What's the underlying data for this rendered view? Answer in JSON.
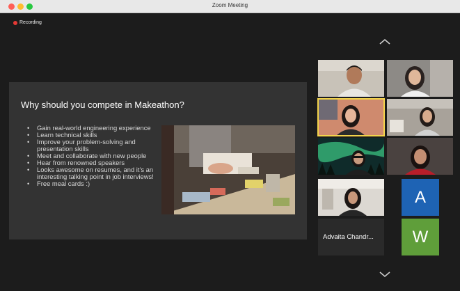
{
  "window": {
    "title": "Zoom Meeting"
  },
  "recording": {
    "label": "Recording",
    "color": "#e53935"
  },
  "navigation": {
    "up_icon": "chevron-up-icon",
    "down_icon": "chevron-down-icon"
  },
  "slide": {
    "title": "Why should you compete in Makeathon?",
    "bullets": [
      "Gain real-world engineering experience",
      "Learn technical skills",
      "Improve your problem-solving and presentation skills",
      "Meet and collaborate with new people",
      "Hear from renowned speakers",
      "Looks awesome on resumes, and it’s an interesting talking point in job interviews!",
      "Free meal cards :)"
    ],
    "photo_alt": "Participants working at a workshop table"
  },
  "participants": {
    "active_speaker_highlight": "#f4d44a",
    "named_tile": {
      "name": "Advaita Chandr..."
    },
    "avatar_a": {
      "initial": "A",
      "color": "#1e63b4"
    },
    "avatar_w": {
      "initial": "W",
      "color": "#5f9e3a"
    }
  }
}
